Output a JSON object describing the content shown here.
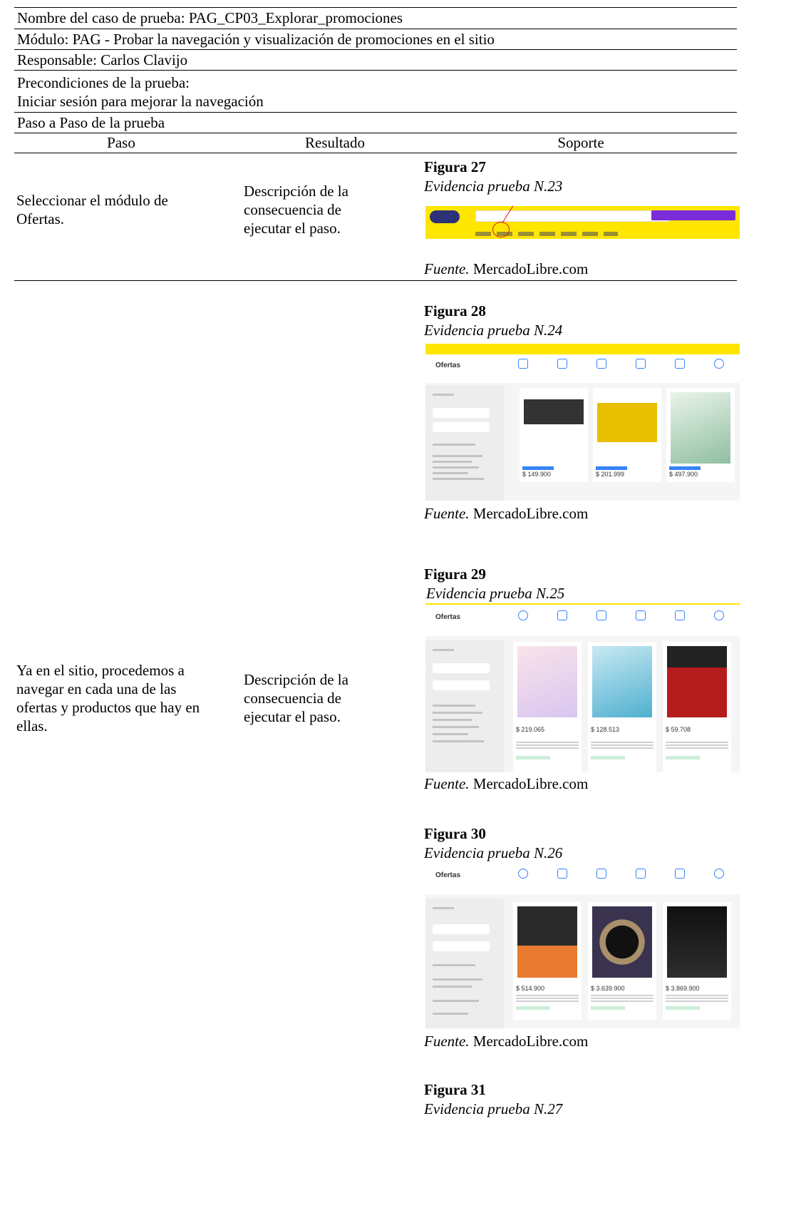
{
  "header": {
    "case_name": "Nombre del caso de prueba: PAG_CP03_Explorar_promociones",
    "module": "Módulo: PAG - Probar la navegación y visualización de promociones en el sitio",
    "responsible": "Responsable: Carlos Clavijo",
    "preconditions_title": "Precondiciones de la prueba:",
    "preconditions_text": "Iniciar sesión para mejorar la navegación",
    "steps_title": "Paso a Paso de la prueba"
  },
  "columns": {
    "step": "Paso",
    "result": "Resultado",
    "support": "Soporte"
  },
  "rows": [
    {
      "step": "Seleccionar el módulo de Ofertas.",
      "result": "Descripción de la consecuencia de ejecutar el paso."
    },
    {
      "step": "Ya en el sitio, procedemos a navegar en cada una de las ofertas y productos que hay en ellas.",
      "result": "Descripción de la consecuencia de ejecutar el paso."
    }
  ],
  "figures": [
    {
      "number": "Figura 27",
      "title": "Evidencia prueba N.23",
      "source_label": "Fuente.",
      "source": "MercadoLibre.com"
    },
    {
      "number": "Figura 28",
      "title": "Evidencia prueba N.24",
      "source_label": "Fuente.",
      "source": "MercadoLibre.com",
      "screenshot": {
        "heading": "Ofertas",
        "prices": [
          "$ 149.900",
          "$ 201.999",
          "$ 497.900"
        ]
      }
    },
    {
      "number": "Figura 29",
      "title": "Evidencia prueba N.25",
      "source_label": "Fuente.",
      "source": "MercadoLibre.com",
      "screenshot": {
        "heading": "Ofertas",
        "prices": [
          "$ 219.065",
          "$ 128.513",
          "$ 59.708"
        ]
      }
    },
    {
      "number": "Figura 30",
      "title": "Evidencia prueba N.26",
      "source_label": "Fuente.",
      "source": "MercadoLibre.com",
      "screenshot": {
        "heading": "Ofertas",
        "prices": [
          "$ 514.900",
          "$ 3.639.900",
          "$ 3.869.900"
        ]
      }
    },
    {
      "number": "Figura 31",
      "title": "Evidencia prueba N.27"
    }
  ],
  "colors": {
    "mercadolibre_yellow": "#ffe600",
    "link_blue": "#3483fa",
    "discount_green": "#00a650"
  }
}
